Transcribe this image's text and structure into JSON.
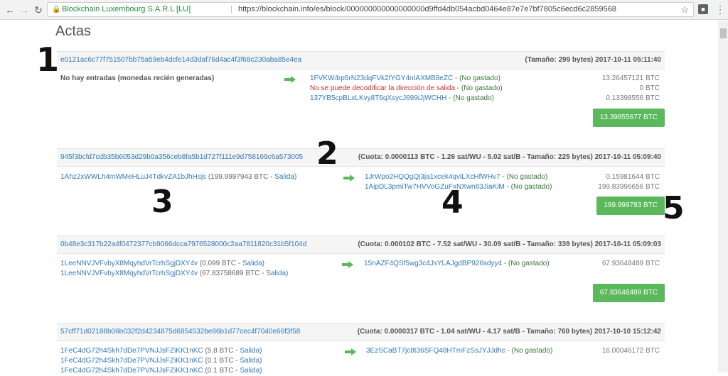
{
  "browser": {
    "site_name": "Blockchain Luxembourg S.A.R.L [LU]",
    "separator": "|",
    "url": "https://blockchain.info/es/block/000000000000000000d9ffd4db054acbd0464e87e7e7bf7805c6ecd6c2859568",
    "back_icon": "arrow-left-icon",
    "forward_icon": "arrow-right-icon",
    "reload_icon": "reload-icon",
    "lock_icon": "lock-icon",
    "star_icon": "star-icon"
  },
  "page_title": "Actas",
  "colors": {
    "link": "#337ab7",
    "unspent": "#3c763d",
    "error": "#c9302c",
    "total_bg": "#5cb85c"
  },
  "annotations": [
    "1",
    "2",
    "3",
    "4",
    "5"
  ],
  "transactions": [
    {
      "hash": "e0121ac6c77f751507bb75a59eb4dcfe14d3daf76d4ac4f3f68c230aba85e4ea",
      "meta": "(Tamaño: 299 bytes) 2017-10-11 05:11:40",
      "inputs_text": "No hay entradas (monedas recién generadas)",
      "outputs": [
        {
          "addr": "1FVKW4rp5rN23dqFVk2fYGY4nIAXMB8eZC",
          "status": " - (No gastado)",
          "amount": "13.26457121 BTC"
        },
        {
          "error": "No se puede decodificar la dirección de salida",
          "status": " - (No gastado)",
          "amount": "0 BTC"
        },
        {
          "addr": "137YB5cpBLxLKvy8T6qXsycJ699iJjWCHH",
          "status": " - (No gastado)",
          "amount": "0.13398556 BTC"
        }
      ],
      "total": "13.39855677 BTC"
    },
    {
      "hash": "945f3bcfd7cdb35b6053d29b0a356ceb8fa5b1d727f111e9d758169c6a573005",
      "meta": "(Cuota: 0.0000113 BTC - 1.26 sat/WU - 5.02 sat/B - Tamaño: 225 bytes) 2017-10-11 05:09:40",
      "inputs": [
        {
          "addr": "1Ahz2xWWLh4mWMeHLuJ4TdkvZA1bJhHsjs",
          "amount": " (199.9997943 BTC - ",
          "link": "Salida",
          "close": ")"
        }
      ],
      "outputs": [
        {
          "addr": "1JrWpo2HQQgQj3ja1xcek4qviLXcHfWHv7",
          "status": " - (No gastado)",
          "amount": "0.15981644 BTC"
        },
        {
          "addr": "1AipDL3pmiTw7HVVoGZuFxNXwn83JiaKiM",
          "status": " - (No gastado)",
          "amount": "199.83996656 BTC"
        }
      ],
      "total": "199.999783 BTC"
    },
    {
      "hash": "0b48e3c317b22a4f0472377cb9066dcca7976528000c2aa7811820c31b5f104d",
      "meta": "(Cuota: 0.000102 BTC - 7.52 sat/WU - 30.09 sat/B - Tamaño: 339 bytes) 2017-10-11 05:09:03",
      "inputs": [
        {
          "addr": "1LeeNNVJVFvbyX8MqyhdVrTcrhSgjDXY4v",
          "amount": " (0.099 BTC - ",
          "link": "Salida",
          "close": ")"
        },
        {
          "addr": "1LeeNNVJVFvbyX8MqyhdVrTcrhSgjDXY4v",
          "amount": " (67.83758689 BTC - ",
          "link": "Salida",
          "close": ")"
        }
      ],
      "outputs": [
        {
          "addr": "15nAZF4QSf5wg3c4JsYLAJgdBP926sdyy4",
          "status": " - (No gastado)",
          "amount": "67.93648489 BTC"
        }
      ],
      "total": "67.93648489 BTC"
    },
    {
      "hash": "57cff71d02188b06b032f2d4234875d6854532be86b1d77cec4f7040e66f3f58",
      "meta": "(Cuota: 0.0000317 BTC - 1.04 sat/WU - 4.17 sat/B - Tamaño: 760 bytes) 2017-10-10 15:12:42",
      "inputs": [
        {
          "addr": "1FeC4dG72h4Skh7dDe7PVNJJsFZiKK1nKC",
          "amount": " (5.8 BTC - ",
          "link": "Salida",
          "close": ")"
        },
        {
          "addr": "1FeC4dG72h4Skh7dDe7PVNJJsFZiKK1nKC",
          "amount": " (0.1 BTC - ",
          "link": "Salida",
          "close": ")"
        },
        {
          "addr": "1FeC4dG72h4Skh7dDe7PVNJJsFZiKK1nKC",
          "amount": " (0.1 BTC - ",
          "link": "Salida",
          "close": ")"
        }
      ],
      "outputs": [
        {
          "addr": "3EzSCaBT7jc8t36SFQ48HTmFzSsJYJJdhc",
          "status": " - (No gastado)",
          "amount": "16.00046172 BTC"
        }
      ]
    }
  ]
}
